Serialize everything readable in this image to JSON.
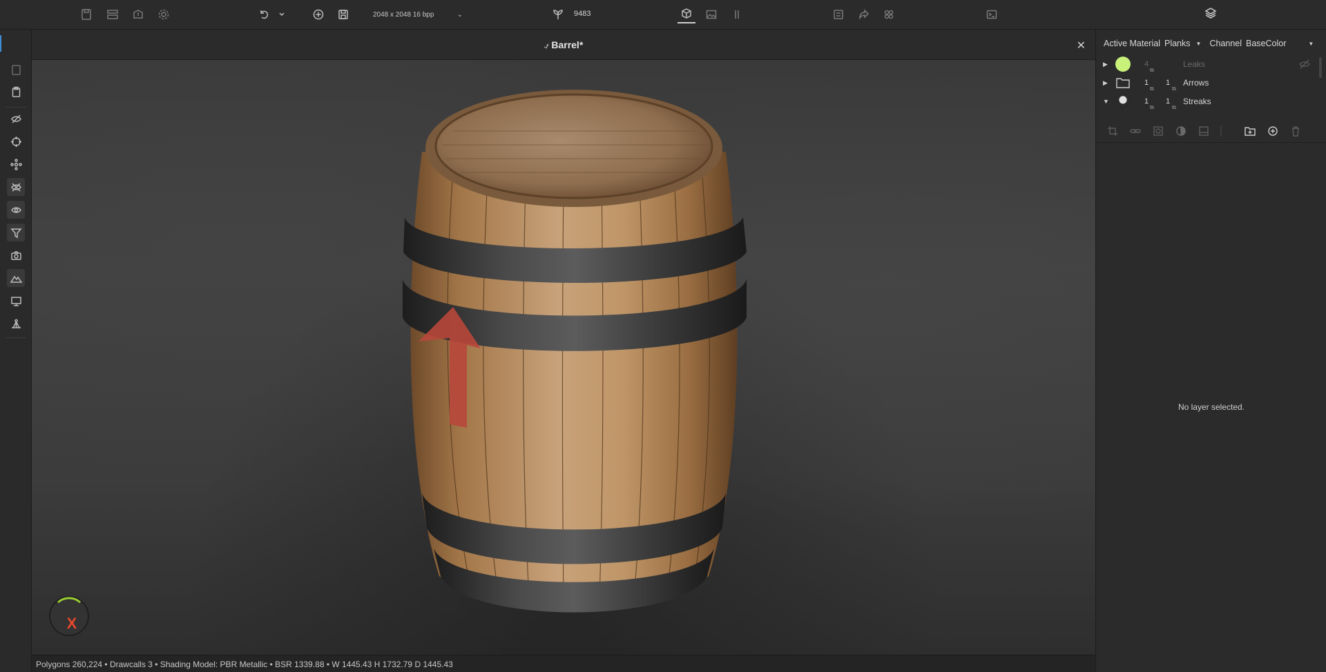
{
  "toolbar": {
    "resolution": "2048 x 2048 16 bpp",
    "seed_value": "9483"
  },
  "document": {
    "title": "Barrel*"
  },
  "right_panel": {
    "active_material_label": "Active Material",
    "material_value": "Planks",
    "channel_label": "Channel",
    "channel_value": "BaseColor",
    "layers": [
      {
        "name": "Leaks",
        "count1": "4",
        "count2": "",
        "thumb_color": "#c8f27a"
      },
      {
        "name": "Arrows",
        "count1": "1",
        "count2": "1",
        "thumb_color": ""
      },
      {
        "name": "Streaks",
        "count1": "1",
        "count2": "1",
        "thumb_color": "#d8d8d8"
      }
    ],
    "empty_message": "No layer selected."
  },
  "status_bar": {
    "text": "Polygons 260,224 • Drawcalls 3 • Shading Model: PBR Metallic • BSR 1339.88 • W 1445.43 H 1732.79 D 1445.43"
  },
  "colors": {
    "accent": "#3f8ed8",
    "gizmo_x": "#e5482d",
    "gizmo_y": "#9acd32",
    "arrow_paint": "#b8473a"
  }
}
